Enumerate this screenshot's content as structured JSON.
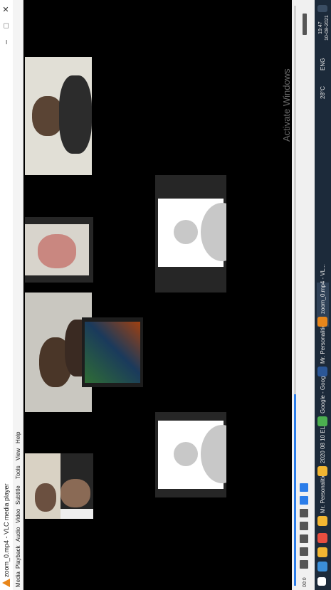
{
  "window": {
    "title": "zoom_0.mp4 - VLC media player",
    "controls": {
      "minimize": "–",
      "maximize": "□",
      "close": "✕"
    }
  },
  "menu": [
    "Media",
    "Playback",
    "Audio",
    "Video",
    "Subtitle",
    "Tools",
    "View",
    "Help"
  ],
  "player": {
    "elapsed": "00:0",
    "progress": 0.33,
    "watermark": "Activate Windows"
  },
  "taskbar": {
    "items": [
      {
        "label": "Mr. Personalities",
        "icon": "folder-icon",
        "color": "#f2b632"
      },
      {
        "label": "2020 08 10 ELC...",
        "icon": "folder-icon",
        "color": "#f2b632"
      },
      {
        "label": "Google - Googl...",
        "icon": "chrome-icon",
        "color": "#4caf50"
      },
      {
        "label": "Mr. Personalitie...",
        "icon": "word-icon",
        "color": "#2b5797"
      },
      {
        "label": "zoom_0.mp4 - VL...",
        "icon": "vlc-icon",
        "color": "#e8861a"
      }
    ],
    "tray": {
      "temp": "28°C",
      "lang": "ENG",
      "time": "19:47",
      "date": "10-08-2021"
    }
  },
  "colors": {
    "accent": "#2b7de9",
    "vlc": "#e8861a",
    "taskbar": "#1c2a3a"
  }
}
